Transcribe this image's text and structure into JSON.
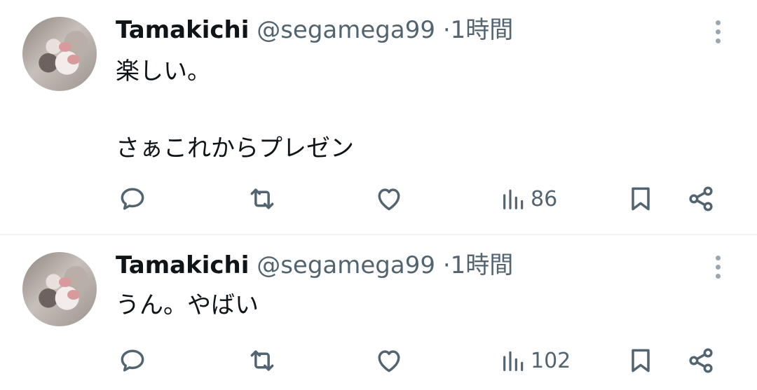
{
  "tweets": [
    {
      "author_name": "Tamakichi",
      "handle": "@segamega99",
      "separator": "·",
      "time": "1時間",
      "text_lines": [
        "楽しい。",
        "",
        "さぁこれからプレゼン"
      ],
      "views": "86"
    },
    {
      "author_name": "Tamakichi",
      "handle": "@segamega99",
      "separator": "·",
      "time": "1時間",
      "text_lines": [
        "うん。やばい"
      ],
      "views": "102"
    }
  ],
  "icons": [
    "reply-icon",
    "retweet-icon",
    "like-icon",
    "views-icon",
    "bookmark-icon",
    "share-icon",
    "more-icon"
  ],
  "colors": {
    "text": "#0f1419",
    "secondary": "#536471",
    "divider": "#eff3f4"
  }
}
